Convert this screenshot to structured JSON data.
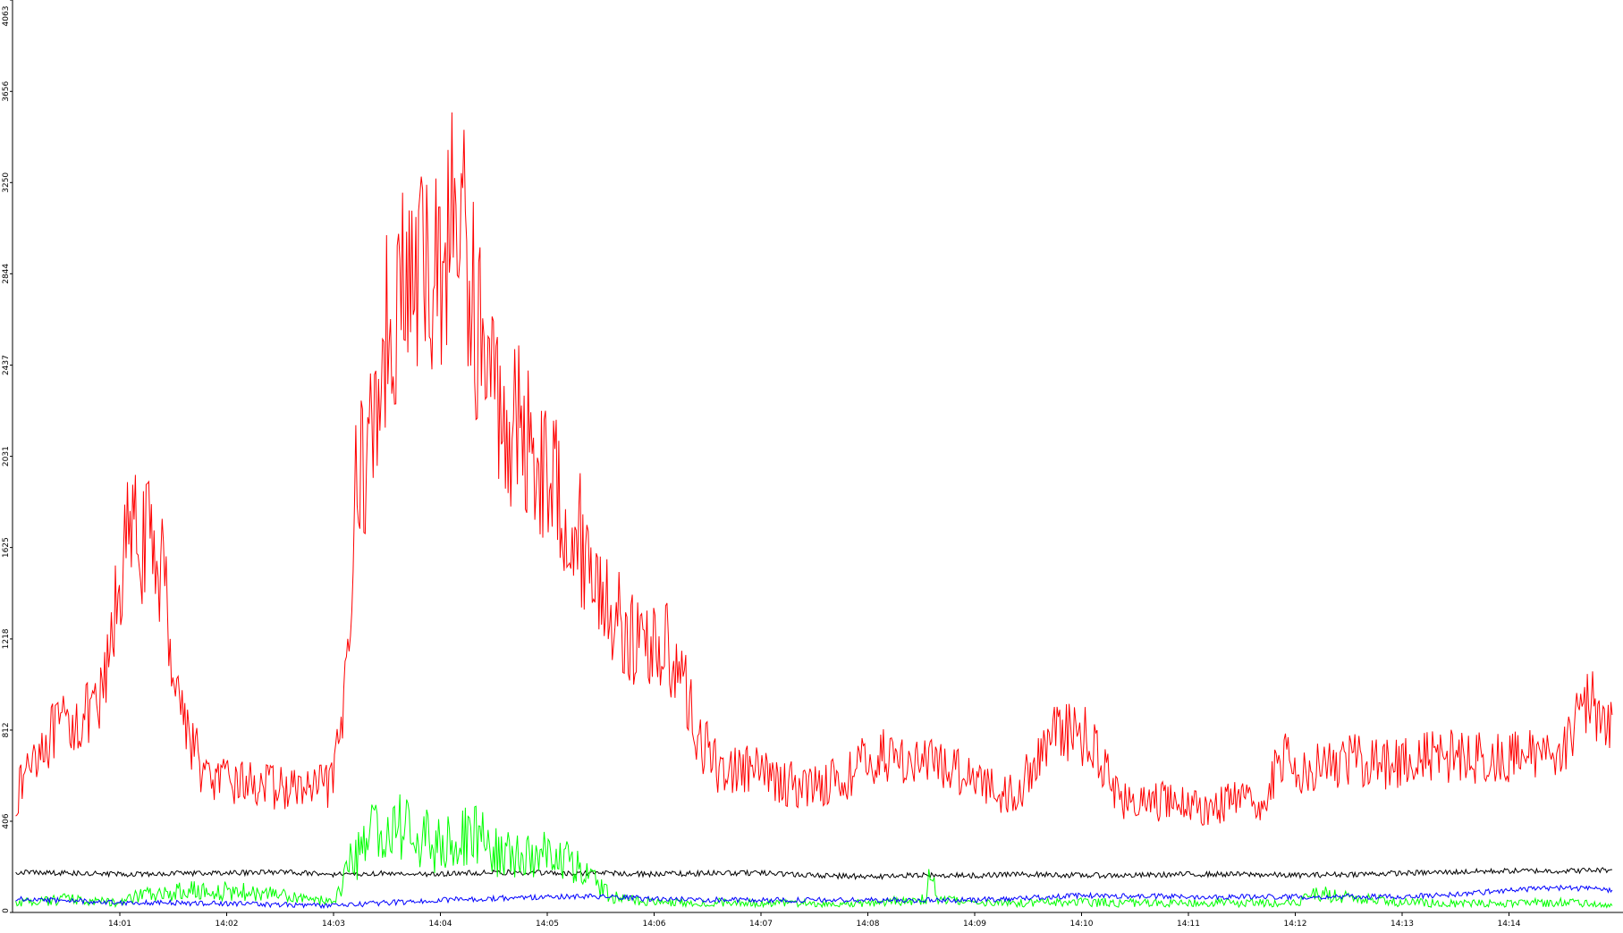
{
  "chart_data": {
    "type": "line",
    "title": "",
    "xlabel": "",
    "ylabel": "",
    "ylim": [
      0,
      4063
    ],
    "x_range": [
      "14:00:02",
      "14:14:59"
    ],
    "yticks": [
      "0",
      "406",
      "812",
      "1218",
      "1625",
      "2031",
      "2437",
      "2844",
      "3250",
      "3656",
      "4063"
    ],
    "xticks": [
      {
        "label": "14:01",
        "minute": 1
      },
      {
        "label": "14:02",
        "minute": 2
      },
      {
        "label": "14:03",
        "minute": 3
      },
      {
        "label": "14:04",
        "minute": 4
      },
      {
        "label": "14:05",
        "minute": 5
      },
      {
        "label": "14:06",
        "minute": 6
      },
      {
        "label": "14:07",
        "minute": 7
      },
      {
        "label": "14:08",
        "minute": 8
      },
      {
        "label": "14:09",
        "minute": 9
      },
      {
        "label": "14:10",
        "minute": 10
      },
      {
        "label": "14:11",
        "minute": 11
      },
      {
        "label": "14:12",
        "minute": 12
      },
      {
        "label": "14:13",
        "minute": 13
      },
      {
        "label": "14:14",
        "minute": 14
      }
    ],
    "grid": false,
    "legend": "none",
    "background": "#ffffff",
    "axis_color": "#000000",
    "series": [
      {
        "color": "#ff0000",
        "x_minutes": [
          0.03,
          0.2,
          0.4,
          0.6,
          0.8,
          0.9,
          1.0,
          1.1,
          1.25,
          1.4,
          1.5,
          1.6,
          1.8,
          2.0,
          2.2,
          2.4,
          2.6,
          2.8,
          3.0,
          3.1,
          3.2,
          3.35,
          3.5,
          3.6,
          3.75,
          3.9,
          4.0,
          4.1,
          4.2,
          4.3,
          4.45,
          4.6,
          4.75,
          4.9,
          5.0,
          5.2,
          5.4,
          5.6,
          5.8,
          6.0,
          6.2,
          6.4,
          6.6,
          6.8,
          7.0,
          7.2,
          7.4,
          7.6,
          7.8,
          8.0,
          8.2,
          8.4,
          8.6,
          8.8,
          9.0,
          9.2,
          9.4,
          9.6,
          9.8,
          9.95,
          10.1,
          10.3,
          10.45,
          10.6,
          10.8,
          11.0,
          11.2,
          11.4,
          11.6,
          11.75,
          11.85,
          12.0,
          12.2,
          12.4,
          12.6,
          12.8,
          13.0,
          13.2,
          13.4,
          13.6,
          13.8,
          14.0,
          14.2,
          14.4,
          14.6,
          14.75,
          14.97
        ],
        "values": [
          500,
          720,
          800,
          860,
          880,
          1100,
          1500,
          1680,
          1650,
          1550,
          1120,
          880,
          600,
          580,
          580,
          560,
          550,
          550,
          570,
          900,
          1850,
          2100,
          2600,
          2750,
          2800,
          2850,
          2900,
          3050,
          3100,
          2750,
          2400,
          2200,
          2150,
          2050,
          1950,
          1800,
          1550,
          1350,
          1200,
          1200,
          1150,
          800,
          640,
          640,
          620,
          580,
          560,
          580,
          600,
          680,
          700,
          680,
          660,
          640,
          620,
          540,
          520,
          700,
          840,
          780,
          780,
          560,
          480,
          480,
          500,
          480,
          460,
          500,
          480,
          500,
          700,
          640,
          660,
          660,
          680,
          660,
          680,
          680,
          700,
          700,
          680,
          680,
          700,
          720,
          800,
          940,
          880
        ]
      },
      {
        "color": "#000000",
        "x_minutes": [
          0.03,
          0.5,
          1.0,
          1.5,
          2.0,
          2.5,
          3.0,
          3.5,
          4.0,
          4.5,
          5.0,
          5.5,
          6.0,
          6.5,
          7.0,
          7.5,
          8.0,
          8.5,
          9.0,
          9.5,
          10.0,
          10.5,
          11.0,
          11.5,
          12.0,
          12.5,
          13.0,
          13.5,
          14.0,
          14.5,
          14.97
        ],
        "values": [
          180,
          175,
          170,
          175,
          175,
          180,
          170,
          175,
          170,
          180,
          175,
          175,
          170,
          175,
          175,
          165,
          160,
          165,
          165,
          170,
          165,
          165,
          170,
          170,
          165,
          170,
          175,
          180,
          185,
          185,
          190
        ]
      },
      {
        "color": "#00ff00",
        "x_minutes": [
          0.03,
          0.5,
          1.0,
          1.2,
          1.5,
          1.8,
          2.2,
          2.6,
          3.0,
          3.2,
          3.4,
          3.6,
          3.8,
          4.0,
          4.2,
          4.4,
          4.6,
          4.8,
          5.0,
          5.2,
          5.4,
          5.6,
          6.0,
          6.5,
          7.0,
          8.0,
          8.55,
          8.6,
          8.65,
          9.0,
          10.0,
          11.0,
          12.0,
          12.2,
          12.4,
          13.0,
          13.5,
          14.0,
          14.5,
          14.97
        ],
        "values": [
          40,
          60,
          40,
          80,
          90,
          100,
          90,
          70,
          50,
          250,
          350,
          380,
          330,
          300,
          320,
          330,
          260,
          260,
          250,
          230,
          150,
          70,
          45,
          45,
          40,
          40,
          60,
          220,
          60,
          40,
          45,
          40,
          45,
          90,
          70,
          45,
          40,
          40,
          45,
          30
        ]
      },
      {
        "color": "#0000ff",
        "x_minutes": [
          0.03,
          1.0,
          2.0,
          3.0,
          4.0,
          5.0,
          5.5,
          6.0,
          7.0,
          8.0,
          9.0,
          10.0,
          11.0,
          12.0,
          13.0,
          13.5,
          14.0,
          14.5,
          14.97
        ],
        "values": [
          60,
          45,
          40,
          30,
          55,
          70,
          70,
          60,
          55,
          55,
          55,
          75,
          70,
          70,
          70,
          80,
          100,
          110,
          100
        ]
      }
    ]
  }
}
